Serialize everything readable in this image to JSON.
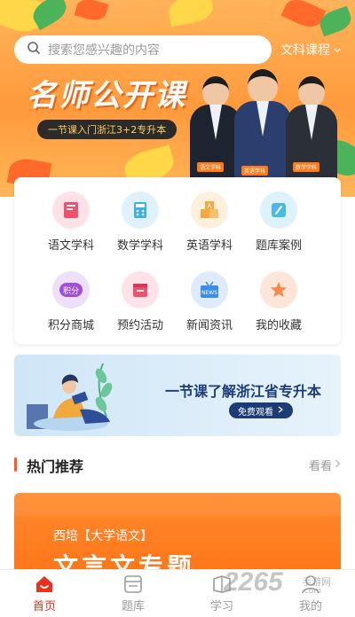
{
  "search": {
    "placeholder": "搜索您感兴趣的内容",
    "category_link": "文科课程"
  },
  "hero": {
    "title": "名师公开课",
    "subtitle": "一节课入门浙江3+2专升本",
    "teachers": [
      {
        "tag": "语文学科"
      },
      {
        "tag": "英语学科"
      },
      {
        "tag": "数学学科"
      }
    ]
  },
  "grid": {
    "items": [
      {
        "label": "语文学科",
        "icon": "chinese-book-icon",
        "color": "#f0506e"
      },
      {
        "label": "数学学科",
        "icon": "calculator-icon",
        "color": "#3ab0e8"
      },
      {
        "label": "英语学科",
        "icon": "abc-blocks-icon",
        "color": "#f6a940"
      },
      {
        "label": "题库案例",
        "icon": "question-bank-icon",
        "color": "#4cb8e8"
      },
      {
        "label": "积分商城",
        "icon": "points-icon",
        "color": "#a24fd8"
      },
      {
        "label": "预约活动",
        "icon": "calendar-icon",
        "color": "#f0506e"
      },
      {
        "label": "新闻资讯",
        "icon": "news-tv-icon",
        "color": "#3a8ee8"
      },
      {
        "label": "我的收藏",
        "icon": "star-icon",
        "color": "#f68a4a"
      }
    ]
  },
  "promo": {
    "title": "一节课了解浙江省专升本",
    "button": "免费观看"
  },
  "section": {
    "title": "热门推荐",
    "more": "看看"
  },
  "course": {
    "tag": "西培【大学语文】",
    "title": "文言文专题"
  },
  "tabbar": {
    "tabs": [
      {
        "label": "首页",
        "active": true
      },
      {
        "label": "题库",
        "active": false
      },
      {
        "label": "学习",
        "active": false
      },
      {
        "label": "我的",
        "active": false
      }
    ]
  },
  "watermark": {
    "brand": "2265",
    "sub": "手游网",
    "sub2": ".com"
  },
  "colors": {
    "accent": "#ff8a2b",
    "active_tab": "#e8321f",
    "section_bar": "#ff5a1f",
    "promo_button": "#1d3c75"
  }
}
